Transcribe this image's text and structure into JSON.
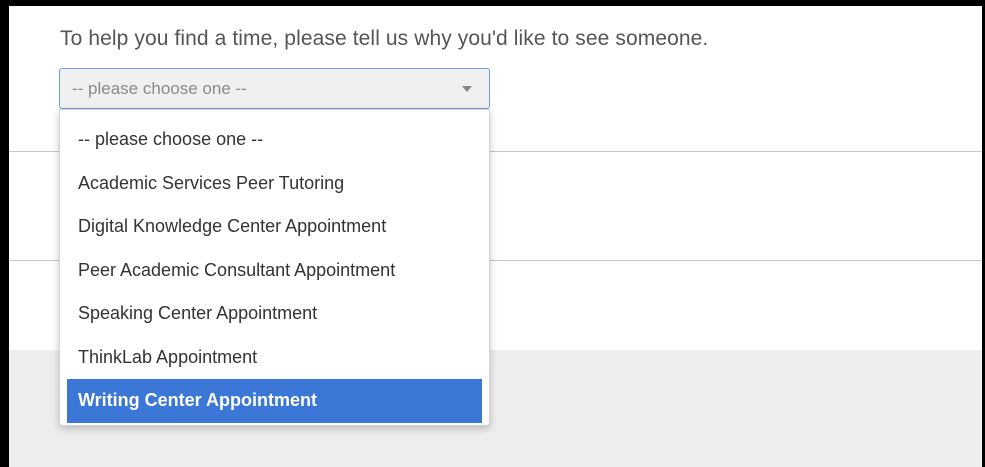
{
  "prompt": "To help you find a time, please tell us why you'd like to see someone.",
  "select": {
    "placeholder": "-- please choose one --",
    "caret_icon": "chevron-down-icon"
  },
  "options": [
    "-- please choose one --",
    "Academic Services Peer Tutoring",
    "Digital Knowledge Center Appointment",
    "Peer Academic Consultant Appointment",
    "Speaking Center Appointment",
    "ThinkLab Appointment",
    "Writing Center Appointment"
  ],
  "highlighted_option_index": 6,
  "colors": {
    "highlight": "#3a77d6",
    "select_border": "#6ea0d8",
    "text": "#333333",
    "muted_text": "#8a8a8a"
  }
}
